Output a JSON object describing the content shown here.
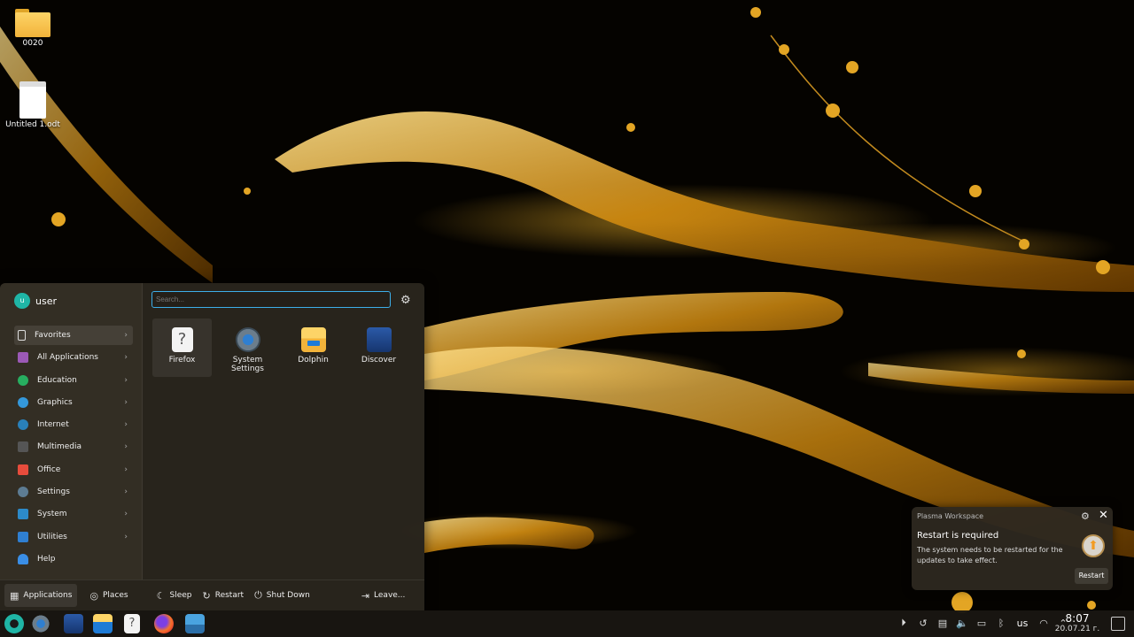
{
  "desktop": {
    "icons": [
      {
        "label": "0020",
        "type": "folder-icon"
      },
      {
        "label": "Untitled 1.odt",
        "type": "document-icon"
      }
    ]
  },
  "launcher": {
    "user": {
      "name": "user",
      "initial": "u"
    },
    "search": {
      "placeholder": "Search..."
    },
    "categories": [
      {
        "label": "Favorites",
        "icon": "bookmark-icon",
        "color": "#3a3a3a"
      },
      {
        "label": "All Applications",
        "icon": "grid-icon",
        "color": "#9b59b6"
      },
      {
        "label": "Education",
        "icon": "education-icon",
        "color": "#27ae60"
      },
      {
        "label": "Graphics",
        "icon": "graphics-icon",
        "color": "#3498db"
      },
      {
        "label": "Internet",
        "icon": "internet-icon",
        "color": "#2980b9"
      },
      {
        "label": "Multimedia",
        "icon": "multimedia-icon",
        "color": "#555555"
      },
      {
        "label": "Office",
        "icon": "office-icon",
        "color": "#e74c3c"
      },
      {
        "label": "Settings",
        "icon": "settings-icon",
        "color": "#5d7c93"
      },
      {
        "label": "System",
        "icon": "system-icon",
        "color": "#2c8ac9"
      },
      {
        "label": "Utilities",
        "icon": "utilities-icon",
        "color": "#2f7fd1"
      },
      {
        "label": "Help",
        "icon": "help-icon",
        "color": "#3a8ee6"
      }
    ],
    "apps": [
      {
        "label": "Firefox",
        "icon": "unknown-app-icon"
      },
      {
        "label": "System Settings",
        "icon": "system-settings-icon"
      },
      {
        "label": "Dolphin",
        "icon": "dolphin-folder-icon"
      },
      {
        "label": "Discover",
        "icon": "discover-icon"
      }
    ],
    "footer": {
      "applications": "Applications",
      "places": "Places",
      "sleep": "Sleep",
      "restart": "Restart",
      "shutdown": "Shut Down",
      "leave": "Leave..."
    }
  },
  "notification": {
    "app_name": "Plasma Workspace",
    "title": "Restart is required",
    "body": "The system needs to be restarted for the updates to take effect.",
    "action": "Restart"
  },
  "taskbar": {
    "keyboard_layout": "us",
    "time": "8:07",
    "date": "20.07.21 г."
  }
}
